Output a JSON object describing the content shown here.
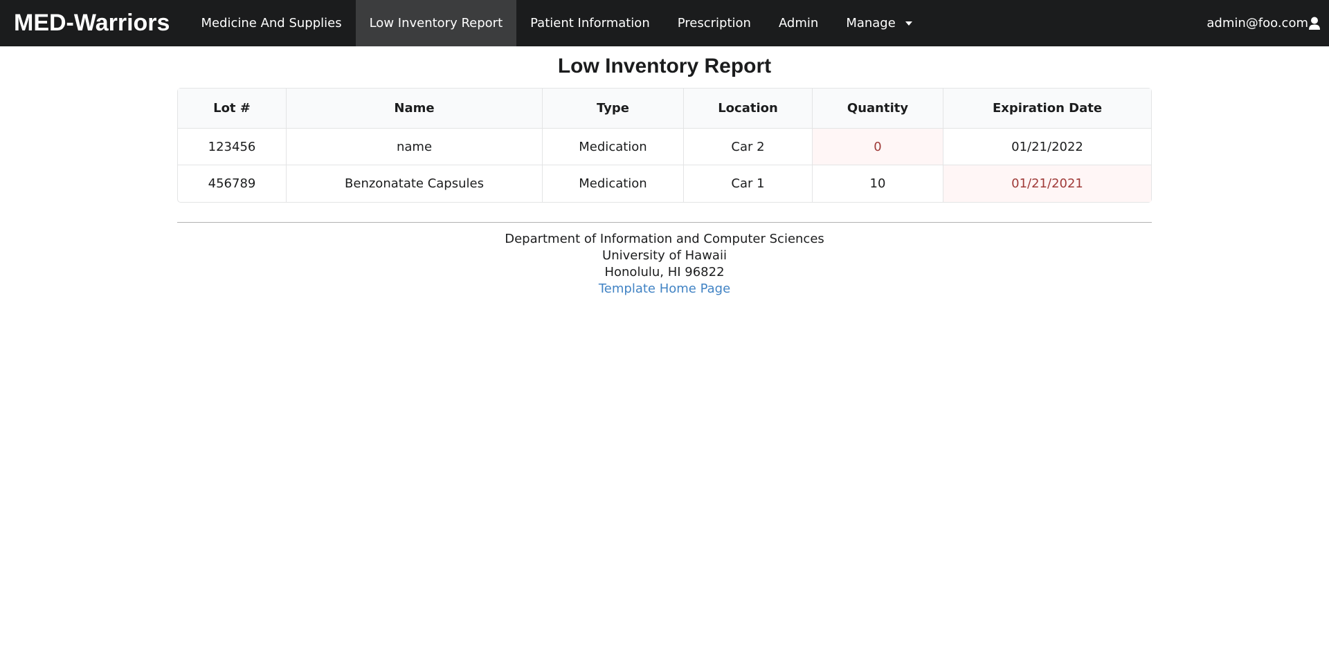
{
  "navbar": {
    "brand": "MED-Warriors",
    "items": [
      {
        "label": "Medicine And Supplies"
      },
      {
        "label": "Low Inventory Report"
      },
      {
        "label": "Patient Information"
      },
      {
        "label": "Prescription"
      },
      {
        "label": "Admin"
      },
      {
        "label": "Manage"
      }
    ],
    "active_item": "Low Inventory Report",
    "user_email": "admin@foo.com",
    "icons": {
      "manage_dropdown": "caret-down-icon",
      "user": "user-icon"
    }
  },
  "page": {
    "title": "Low Inventory Report"
  },
  "table": {
    "headers": [
      "Lot #",
      "Name",
      "Type",
      "Location",
      "Quantity",
      "Expiration Date"
    ],
    "rows": [
      {
        "lot": "123456",
        "name": "name",
        "type": "Medication",
        "location": "Car 2",
        "quantity": "0",
        "expiration": "01/21/2022"
      },
      {
        "lot": "456789",
        "name": "Benzonatate Capsules",
        "type": "Medication",
        "location": "Car 1",
        "quantity": "10",
        "expiration": "01/21/2021"
      }
    ],
    "colors": {
      "warning_bg": "#fff6f6",
      "warning_text": "#9f3a38"
    }
  },
  "footer": {
    "line1": "Department of Information and Computer Sciences",
    "line2": "University of Hawaii",
    "line3": "Honolulu, HI 96822",
    "link": "Template Home Page"
  },
  "colors": {
    "navbar_bg": "#1b1c1d",
    "navbar_active": "#3c3d3e",
    "link": "#4183c4"
  }
}
